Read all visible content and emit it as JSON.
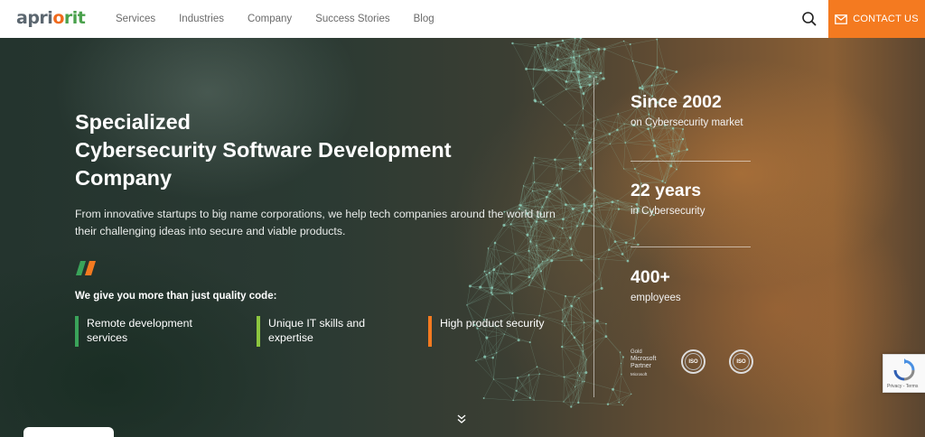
{
  "header": {
    "logo": {
      "part1": "apri",
      "part2": "o",
      "part3": "rit"
    },
    "nav": [
      "Services",
      "Industries",
      "Company",
      "Success Stories",
      "Blog"
    ],
    "contact_label": "CONTACT US",
    "icons": {
      "search": "search-icon",
      "mail": "mail-icon"
    }
  },
  "hero": {
    "title_lines": [
      "Specialized",
      "Cybersecurity Software Development",
      "Company"
    ],
    "lead": "From innovative startups to big name corporations, we help tech companies around the world turn their challenging ideas into secure and viable products.",
    "give_heading": "We give you more than just quality code:",
    "features": [
      "Remote development services",
      "Unique IT skills and expertise",
      "High product security"
    ],
    "feature_colors": [
      "#3aa35a",
      "#8cc63f",
      "#f47a20"
    ]
  },
  "stats": [
    {
      "value": "Since 2002",
      "label": "on Cybersecurity market"
    },
    {
      "value": "22 years",
      "label": "in Cybersecurity"
    },
    {
      "value": "400+",
      "label": "employees"
    }
  ],
  "badges": {
    "ms_gold": "Gold",
    "ms_line1": "Microsoft",
    "ms_line2": "Partner",
    "ms_small": "Microsoft",
    "iso1": "ISO",
    "iso2": "ISO"
  },
  "recaptcha": {
    "links": "Privacy - Terms"
  },
  "colors": {
    "accent": "#f47a20",
    "green": "#4aa14c",
    "header_bg": "#ffffff"
  }
}
